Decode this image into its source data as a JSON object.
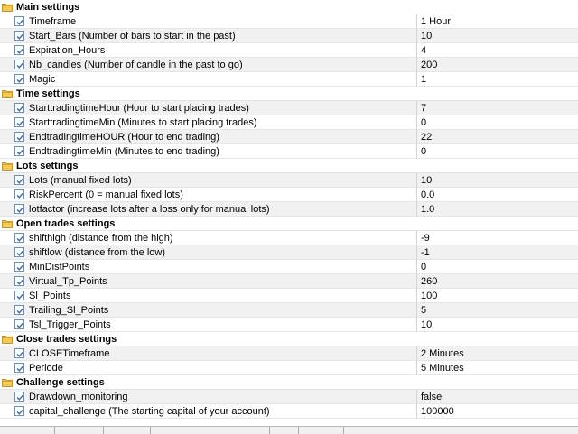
{
  "sections": [
    {
      "title": "Main settings",
      "rows": [
        {
          "name": "Timeframe",
          "value": "1 Hour"
        },
        {
          "name": "Start_Bars (Number of bars to start in the past)",
          "value": "10"
        },
        {
          "name": "Expiration_Hours",
          "value": "4"
        },
        {
          "name": "Nb_candles (Number of candle in the past to go)",
          "value": "200"
        },
        {
          "name": "Magic",
          "value": "1"
        }
      ]
    },
    {
      "title": "Time settings",
      "rows": [
        {
          "name": "StarttradingtimeHour (Hour to start placing trades)",
          "value": "7"
        },
        {
          "name": "StarttradingtimeMin (Minutes to start placing trades)",
          "value": "0"
        },
        {
          "name": "EndtradingtimeHOUR (Hour to end trading)",
          "value": "22"
        },
        {
          "name": "EndtradingtimeMin (Minutes to end trading)",
          "value": "0"
        }
      ]
    },
    {
      "title": "Lots settings",
      "rows": [
        {
          "name": "Lots (manual fixed lots)",
          "value": "10"
        },
        {
          "name": "RiskPercent (0 = manual fixed lots)",
          "value": "0.0"
        },
        {
          "name": "lotfactor (increase lots after a loss only for manual lots)",
          "value": "1.0"
        }
      ]
    },
    {
      "title": "Open trades settings",
      "rows": [
        {
          "name": "shifthigh (distance from the high)",
          "value": "-9"
        },
        {
          "name": "shiftlow (distance from the low)",
          "value": "-1"
        },
        {
          "name": "MinDistPoints",
          "value": "0"
        },
        {
          "name": "Virtual_Tp_Points",
          "value": "260"
        },
        {
          "name": "Sl_Points",
          "value": "100"
        },
        {
          "name": "Trailing_Sl_Points",
          "value": "5"
        },
        {
          "name": "Tsl_Trigger_Points",
          "value": "10"
        }
      ]
    },
    {
      "title": "Close trades settings",
      "rows": [
        {
          "name": "CLOSETimeframe",
          "value": "2 Minutes"
        },
        {
          "name": "Periode",
          "value": "5 Minutes"
        }
      ]
    },
    {
      "title": "Challenge settings",
      "rows": [
        {
          "name": "Drawdown_monitoring",
          "value": "false"
        },
        {
          "name": "capital_challenge (The starting capital of your account)",
          "value": "100000"
        }
      ]
    }
  ],
  "colors": {
    "folder": "#e8b63a",
    "checkbox_border": "#6e8fb8",
    "checkmark": "#2f6fb8",
    "alt_row": "#f1f1f1"
  },
  "icons": {
    "section": "folder-icon",
    "row": "checkbox-checked-icon"
  }
}
